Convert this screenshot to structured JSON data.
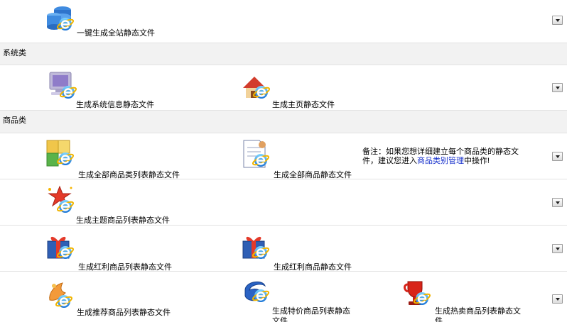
{
  "rows": {
    "one_click": {
      "label": "一键生成全站静态文件"
    },
    "system": {
      "header": "系统类",
      "sysinfo": "生成系统信息静态文件",
      "homepage": "生成主页静态文件"
    },
    "products": {
      "header": "商品类",
      "all_category_list": "生成全部商品类列表静态文件",
      "all_products": "生成全部商品静态文件",
      "note_prefix": "备注：如果您想详细建立每个商品类的静态文件，建议您进入",
      "note_link": "商品类别管理",
      "note_suffix": "中操作!",
      "topic_list": "生成主题商品列表静态文件",
      "bonus_list": "生成红利商品列表静态文件",
      "bonus_products": "生成红利商品静态文件",
      "recommend_list": "生成推荐商品列表静态文件",
      "special_price_list": "生成特价商品列表静态文件",
      "hot_sale_list": "生成热卖商品列表静态文件"
    }
  },
  "icons": {
    "ie_badge": "ie-e-icon",
    "database": "database-stack-icon",
    "monitor": "monitor-icon",
    "house": "house-icon",
    "boxes": "boxes-icon",
    "document": "document-icon",
    "star": "star-icon",
    "gift": "gift-icon",
    "pencil": "pencil-icon",
    "swirl": "swirl-icon",
    "trophy": "trophy-cup-icon"
  }
}
